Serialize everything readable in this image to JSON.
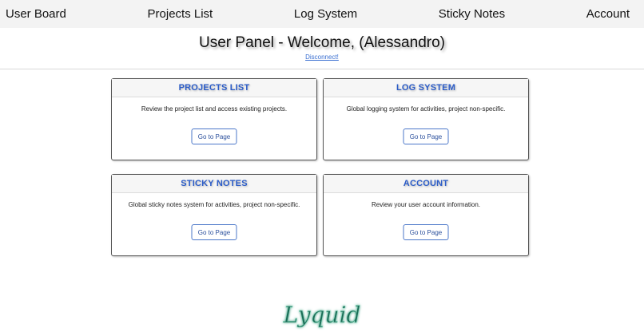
{
  "nav": {
    "items": [
      "User Board",
      "Projects List",
      "Log System",
      "Sticky Notes",
      "Account"
    ]
  },
  "header": {
    "title": "User Panel - Welcome, (Alessandro)",
    "disconnect": "Disconnect!"
  },
  "cards": [
    {
      "title": "PROJECTS LIST",
      "description": "Review the project list and access existing projects.",
      "button": "Go to Page"
    },
    {
      "title": "LOG SYSTEM",
      "description": "Global logging system for activities, project non-specific.",
      "button": "Go to Page"
    },
    {
      "title": "STICKY NOTES",
      "description": "Global sticky notes system for activities, project non-specific.",
      "button": "Go to Page"
    },
    {
      "title": "ACCOUNT",
      "description": "Review your user account information.",
      "button": "Go to Page"
    }
  ],
  "footer": {
    "logo_text": "Lyquid"
  },
  "colors": {
    "accent": "#2b5cc8",
    "nav_bg": "#f3f3f3",
    "logo": "#1f6b57"
  }
}
